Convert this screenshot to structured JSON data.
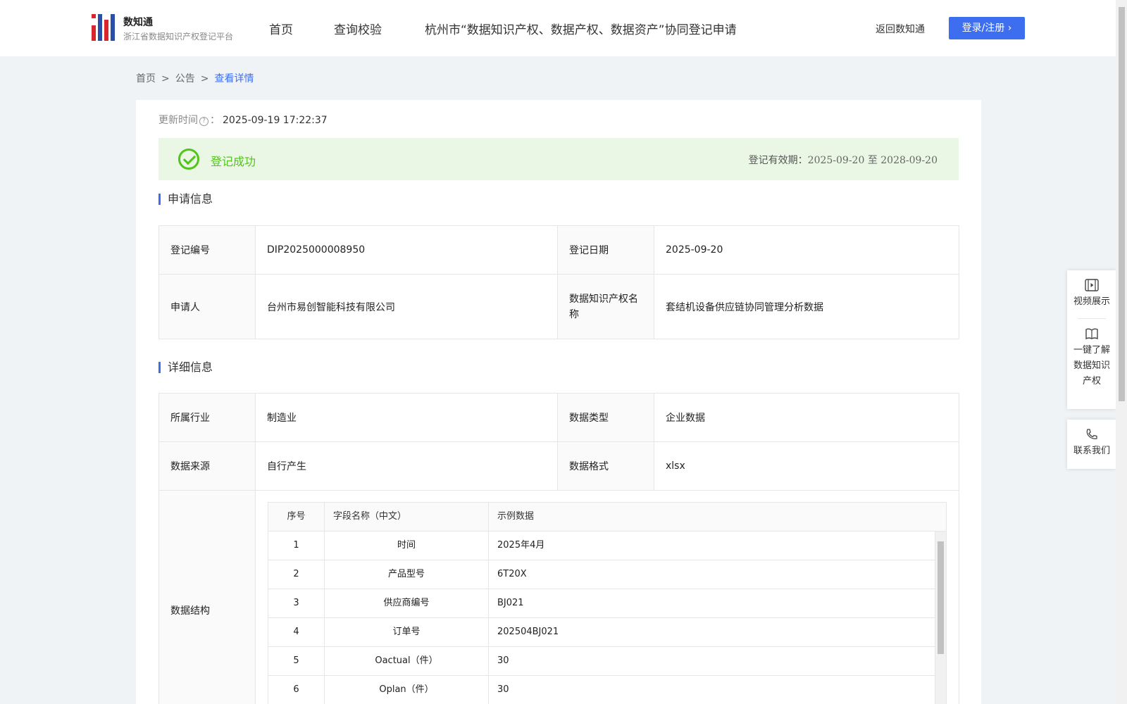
{
  "header": {
    "brand_title": "数知通",
    "brand_subtitle": "浙江省数据知识产权登记平台",
    "nav": [
      "首页",
      "查询校验",
      "杭州市“数据知识产权、数据产权、数据资产”协同登记申请"
    ],
    "back_link": "返回数知通",
    "login_button": "登录/注册 ›"
  },
  "breadcrumb": {
    "items": [
      "首页",
      "公告"
    ],
    "separator": ">",
    "current": "查看详情"
  },
  "update": {
    "label": "更新时间",
    "suffix": "：",
    "value": "2025-09-19 17:22:37"
  },
  "status": {
    "text": "登记成功",
    "validity_label": "登记有效期：",
    "validity_value": "2025-09-20 至 2028-09-20"
  },
  "section_apply": "申请信息",
  "apply": {
    "reg_no_label": "登记编号",
    "reg_no": "DIP2025000008950",
    "reg_date_label": "登记日期",
    "reg_date": "2025-09-20",
    "applicant_label": "申请人",
    "applicant": "台州市易创智能科技有限公司",
    "ip_name_label": "数据知识产权名称",
    "ip_name": "套结机设备供应链协同管理分析数据"
  },
  "section_detail": "详细信息",
  "detail": {
    "industry_label": "所属行业",
    "industry": "制造业",
    "data_type_label": "数据类型",
    "data_type": "企业数据",
    "source_label": "数据来源",
    "source": "自行产生",
    "format_label": "数据格式",
    "format": "xlsx",
    "structure_label": "数据结构"
  },
  "structure_table": {
    "headers": [
      "序号",
      "字段名称（中文）",
      "示例数据"
    ],
    "rows": [
      [
        "1",
        "时间",
        "2025年4月"
      ],
      [
        "2",
        "产品型号",
        "6T20X"
      ],
      [
        "3",
        "供应商编号",
        "BJ021"
      ],
      [
        "4",
        "订单号",
        "202504BJ021"
      ],
      [
        "5",
        "Oactual（件）",
        "30"
      ],
      [
        "6",
        "Oplan（件）",
        "30"
      ]
    ]
  },
  "float_menu": {
    "video": "视频展示",
    "learn": "一键了解数据知识产权",
    "contact": "联系我们"
  },
  "colors": {
    "accent": "#3d6ef0",
    "success": "#52c41a",
    "success_bg": "#e9f7e4"
  }
}
